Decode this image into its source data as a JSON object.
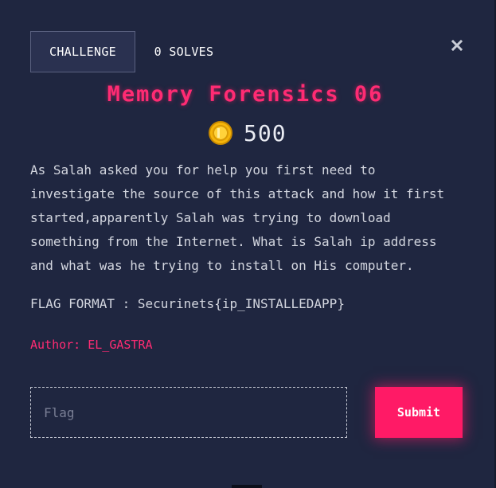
{
  "tabs": {
    "challenge_label": "CHALLENGE",
    "solves_label": "0 SOLVES"
  },
  "close": {
    "icon": "close-icon"
  },
  "challenge": {
    "title": "Memory Forensics 06",
    "points": "500",
    "coin_icon": "coin-icon",
    "description": "As Salah asked you for help you first need to investigate the source of this attack and how it first started,apparently Salah was trying to download something from the Internet. What is Salah ip address and what was he trying to install on His computer.",
    "flag_format": "FLAG FORMAT : Securinets{ip_INSTALLEDAPP}",
    "author": "Author: EL_GASTRA"
  },
  "form": {
    "flag_placeholder": "Flag",
    "flag_value": "",
    "submit_label": "Submit"
  },
  "colors": {
    "background": "#1f2640",
    "accent": "#ff1a66",
    "title": "#ff2b73",
    "coin": "#f5b50a"
  }
}
